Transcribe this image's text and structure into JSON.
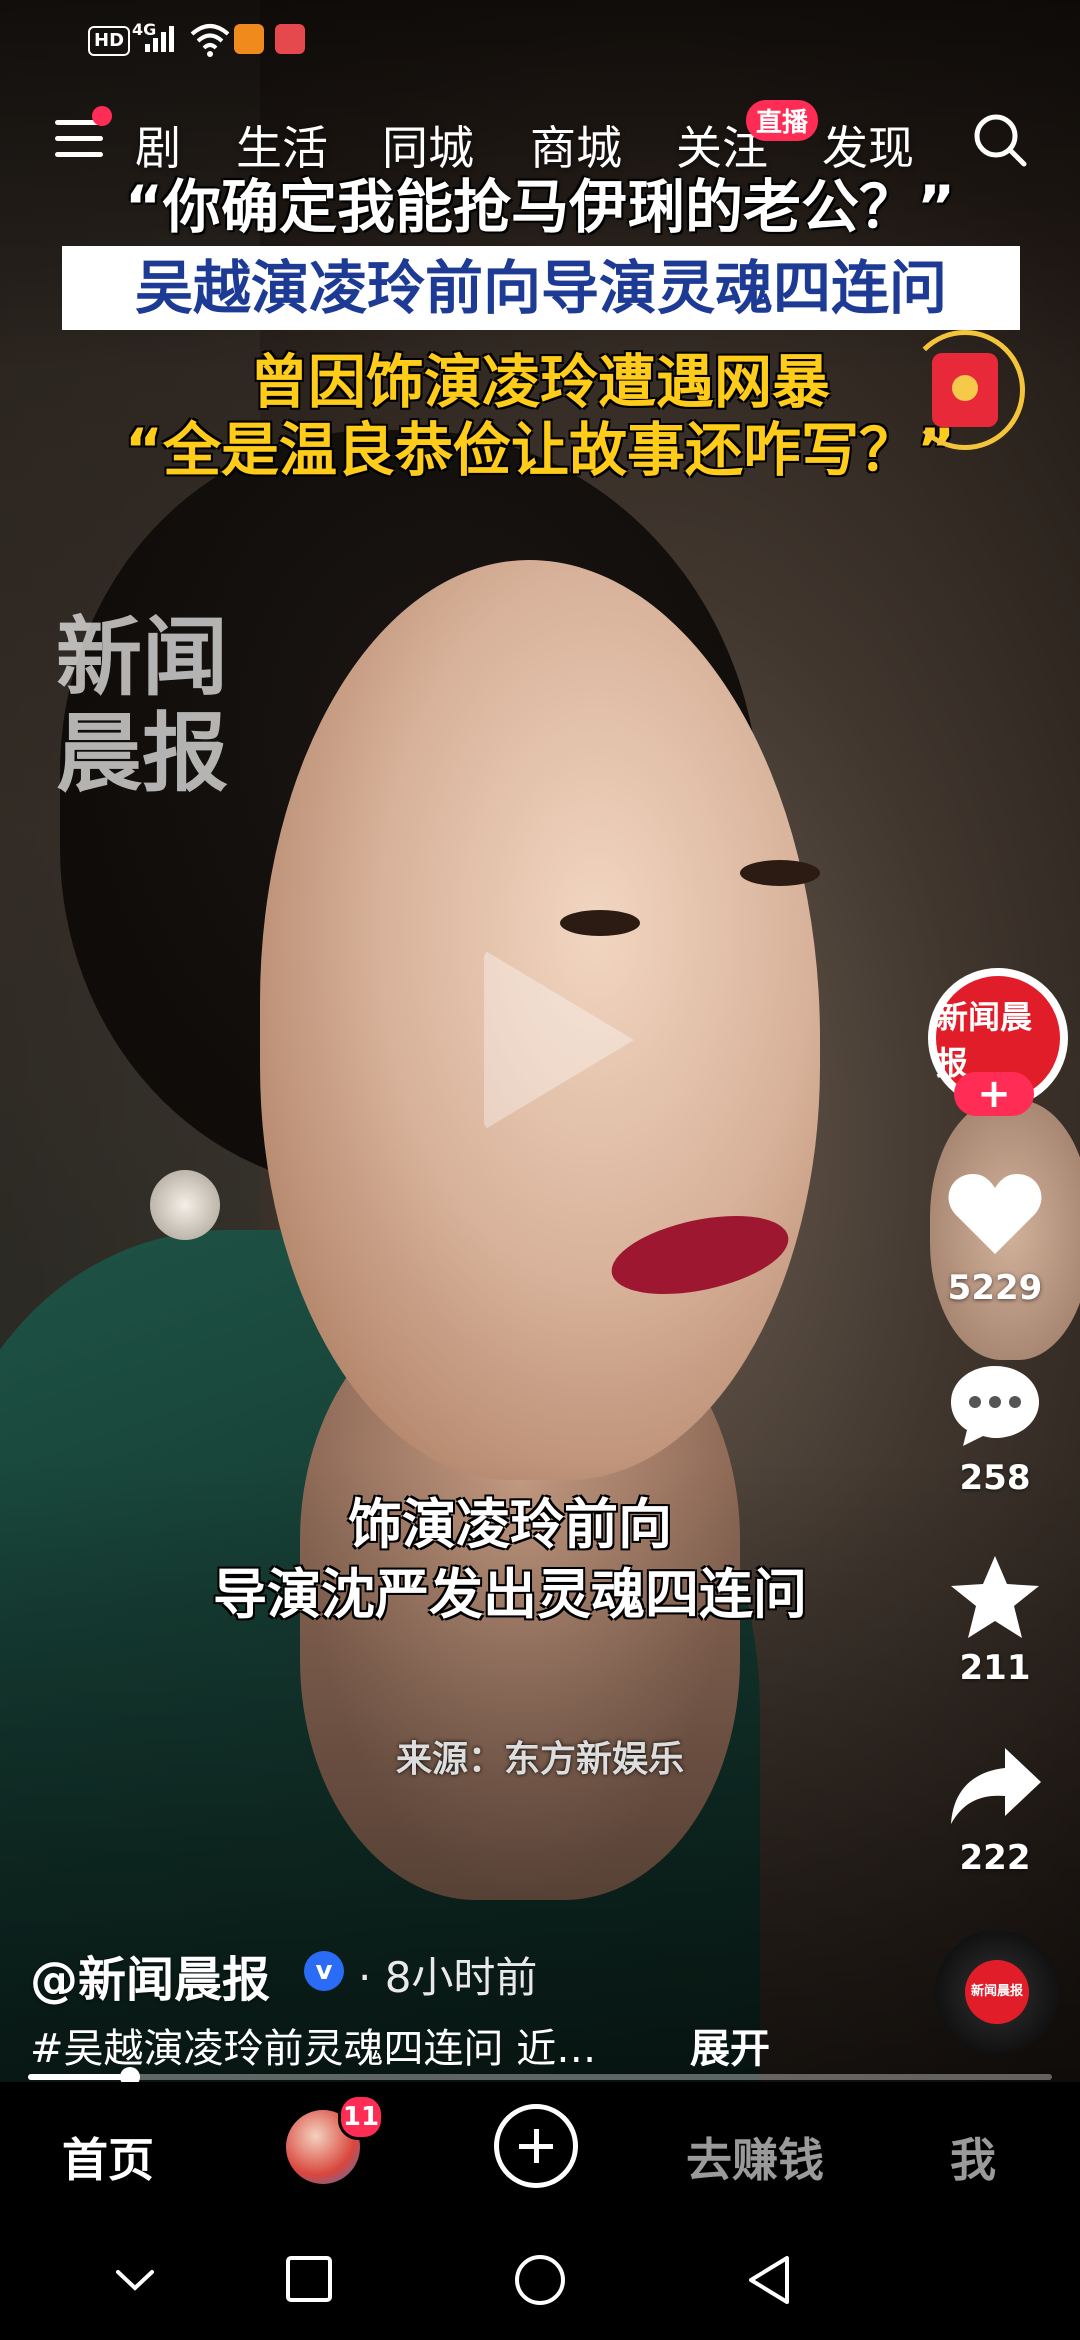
{
  "status_bar": {
    "hd": "HD",
    "network": "4G"
  },
  "top_nav": {
    "tabs": [
      "剧",
      "生活",
      "同城",
      "商城",
      "关注",
      "发现"
    ],
    "live_badge": "直播"
  },
  "overlay_text": {
    "line1": "“你确定我能抢马伊琍的老公？”",
    "line2": "吴越演凌玲前向导演灵魂四连问",
    "line3a": "曾因饰演凌玲遭遇网暴",
    "line3b": "“全是温良恭俭让故事还咋写？”"
  },
  "watermark": {
    "line1": "新闻",
    "line2": "晨报"
  },
  "subtitle": {
    "line1": "饰演凌玲前向",
    "line2": "导演沈严发出灵魂四连问"
  },
  "source": "来源：东方新娱乐",
  "right_rail": {
    "avatar_text": "新闻晨报",
    "follow": "+",
    "likes": "5229",
    "comments": "258",
    "favorites": "211",
    "shares": "222"
  },
  "video_info": {
    "author": "@新闻晨报",
    "verified_mark": "v",
    "time": "· 8小时前",
    "description": "#吴越演凌玲前灵魂四连问 近…",
    "expand": "展开",
    "progress": 0.1
  },
  "bottom_tabs": {
    "home": "首页",
    "friend_badge": "11",
    "earn": "去赚钱",
    "me": "我"
  },
  "colors": {
    "accent": "#ff2d55",
    "caption_yellow": "#ffcc1a",
    "caption_blue": "#1d3b94"
  }
}
